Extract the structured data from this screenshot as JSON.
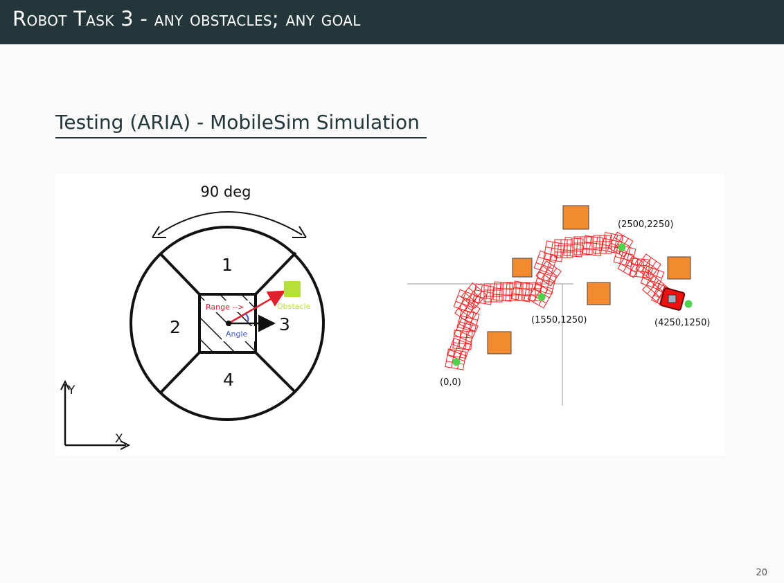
{
  "header": {
    "title": "Robot Task 3 - any obstacles; any goal"
  },
  "section": {
    "title": "Testing (ARIA) - MobileSim Simulation"
  },
  "diagram": {
    "fov_label": "90 deg",
    "zones": [
      "1",
      "2",
      "3",
      "4"
    ],
    "range_label": "Range -->",
    "angle_label": "Angle",
    "obstacle_label": "Obstacle",
    "axis_y": "Y",
    "axis_x": "X",
    "colors": {
      "range": "#e0202a",
      "angle": "#3b55c8",
      "obstacle": "#b5e03a"
    }
  },
  "simulation": {
    "points": [
      {
        "label": "(0,0)"
      },
      {
        "label": "(1550,1250)"
      },
      {
        "label": "(2500,2250)"
      },
      {
        "label": "(4250,1250)"
      }
    ],
    "colors": {
      "path": "#ff1a1a",
      "obstacle": "#f28a30",
      "waypoint": "#4cd44c"
    }
  },
  "footer": {
    "page_number": "20"
  }
}
